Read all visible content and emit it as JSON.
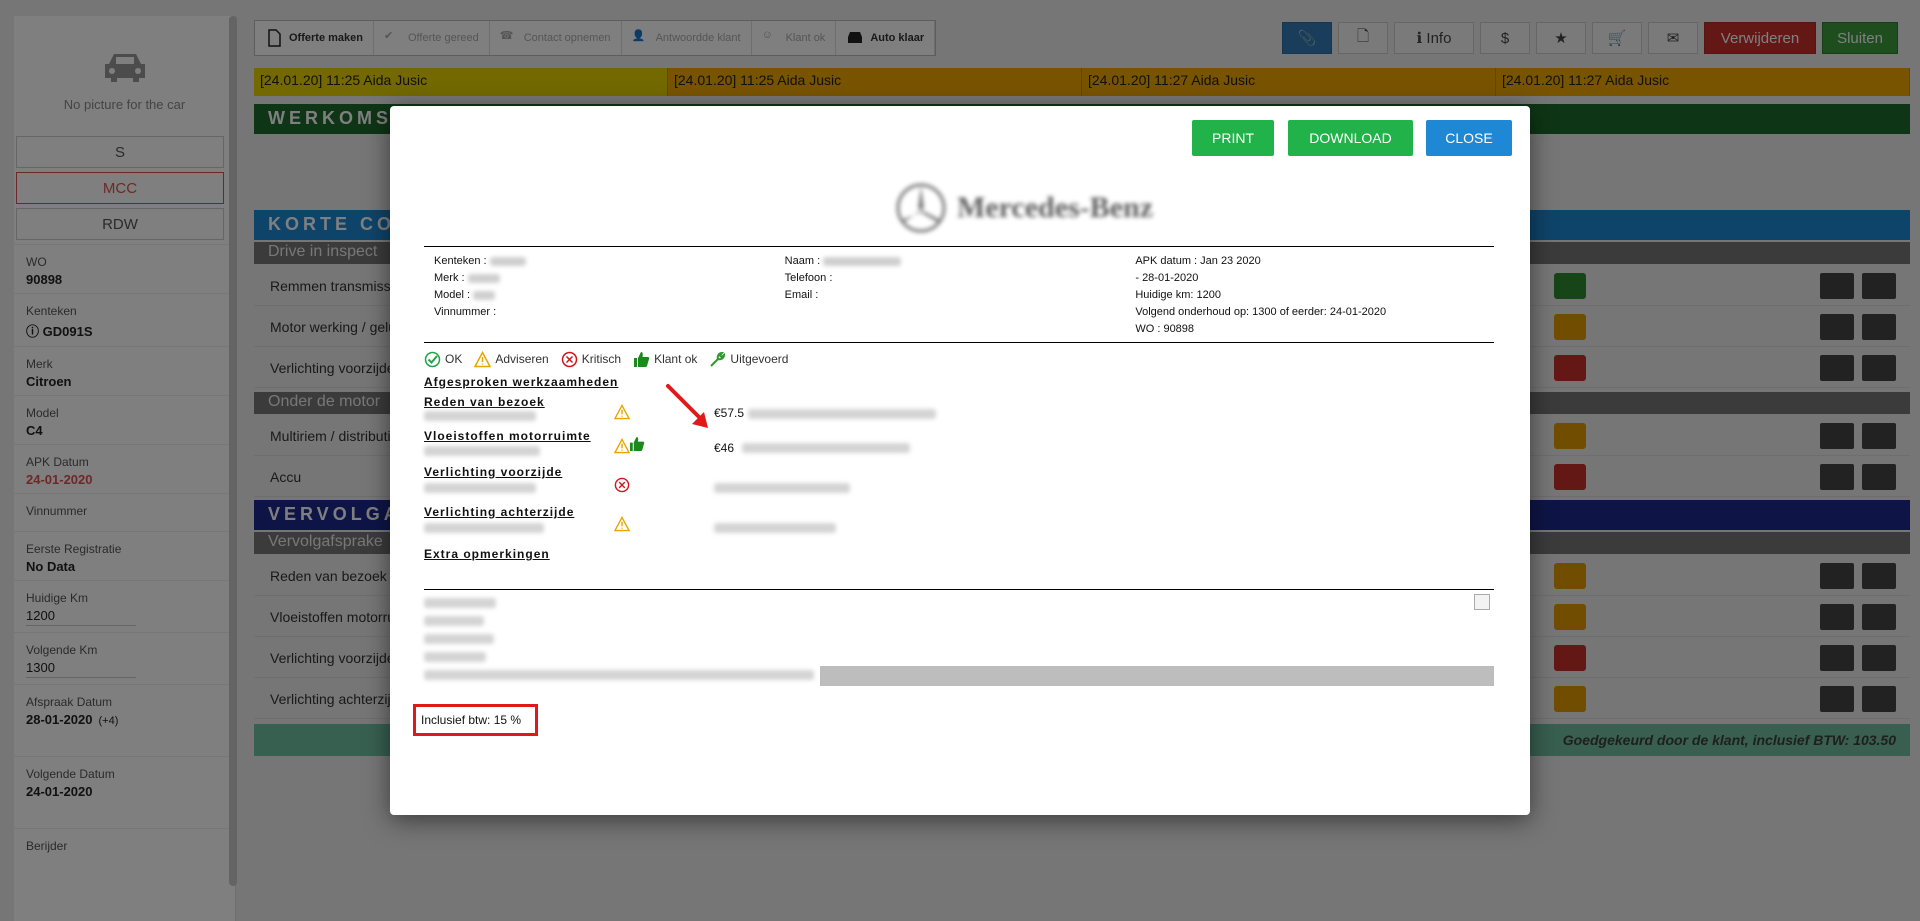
{
  "sidebar": {
    "no_picture": "No picture for the car",
    "buttons": [
      "S",
      "MCC",
      "RDW"
    ],
    "fields": {
      "wo_label": "WO",
      "wo": "90898",
      "kenteken_label": "Kenteken",
      "kenteken": "GD091S",
      "merk_label": "Merk",
      "merk": "Citroen",
      "model_label": "Model",
      "model": "C4",
      "apk_label": "APK Datum",
      "apk": "24-01-2020",
      "vinnummer_label": "Vinnummer",
      "eerste_label": "Eerste Registratie",
      "eerste": "No Data",
      "km_label": "Huidige Km",
      "km": "1200",
      "volgende_km_label": "Volgende Km",
      "volgende_km": "1300",
      "afspraak_label": "Afspraak Datum",
      "afspraak": "28-01-2020",
      "afspraak_extra": "(+4)",
      "volgende_datum_label": "Volgende Datum",
      "volgende_datum": "24-01-2020",
      "berijder_label": "Berijder"
    }
  },
  "toolbar": {
    "steps": [
      "Offerte maken",
      "Offerte gereed",
      "Contact opnemen",
      "Antwoordde klant",
      "Klant ok",
      "Auto klaar"
    ],
    "info": "Info",
    "verwijderen": "Verwijderen",
    "sluiten": "Sluiten"
  },
  "notes": [
    "[24.01.20] 11:25  Aida Jusic",
    "[24.01.20] 11:25  Aida Jusic",
    "[24.01.20] 11:27  Aida Jusic",
    "[24.01.20] 11:27  Aida Jusic"
  ],
  "sections": {
    "werkomschrijving": "WERKOMS",
    "korte": "KORTE CO",
    "drive": "Drive in inspect",
    "onder": "Onder de motor",
    "vervolg": "VERVOLGA",
    "vervolg_sub": "Vervolgafsprake",
    "rows": [
      "Remmen transmissie",
      "Motor werking / gelu",
      "Verlichting voorzijde",
      "Multiriem / distributi",
      "Accu",
      "Reden van bezoek",
      "Vloeistoffen motorru",
      "Verlichting voorzijde",
      "Verlichting achterzijde"
    ],
    "approved": "Goedgekeurd door de klant, inclusief BTW: 103.50"
  },
  "modal": {
    "print": "PRINT",
    "download": "DOWNLOAD",
    "close": "CLOSE",
    "logo_text": "Mercedes-Benz",
    "info": {
      "kenteken": "Kenteken :",
      "merk": "Merk :",
      "model": "Model :",
      "vinnummer": "Vinnummer :",
      "naam": "Naam :",
      "telefoon": "Telefoon :",
      "email": "Email :",
      "apk": "APK datum : Jan 23 2020",
      "date": "- 28-01-2020",
      "km": "Huidige km: 1200",
      "onderhoud": "Volgend onderhoud op: 1300 of eerder: 24-01-2020",
      "wo": "WO : 90898"
    },
    "legend": [
      "OK",
      "Adviseren",
      "Kritisch",
      "Klant ok",
      "Uitgevoerd"
    ],
    "work": {
      "afgesproken": "Afgesproken werkzaamheden",
      "reden": "Reden van bezoek",
      "price1": "€57.5",
      "vloeistoffen": "Vloeistoffen motorruimte",
      "price2": "€46",
      "voorzijde": "Verlichting voorzijde",
      "achterzijde": "Verlichting achterzijde",
      "extra": "Extra opmerkingen"
    },
    "btw": "Inclusief btw: 15 %"
  },
  "colors": {
    "accent_green": "#21b349",
    "accent_blue": "#1e88d4",
    "highlight_red": "#e0191a"
  }
}
